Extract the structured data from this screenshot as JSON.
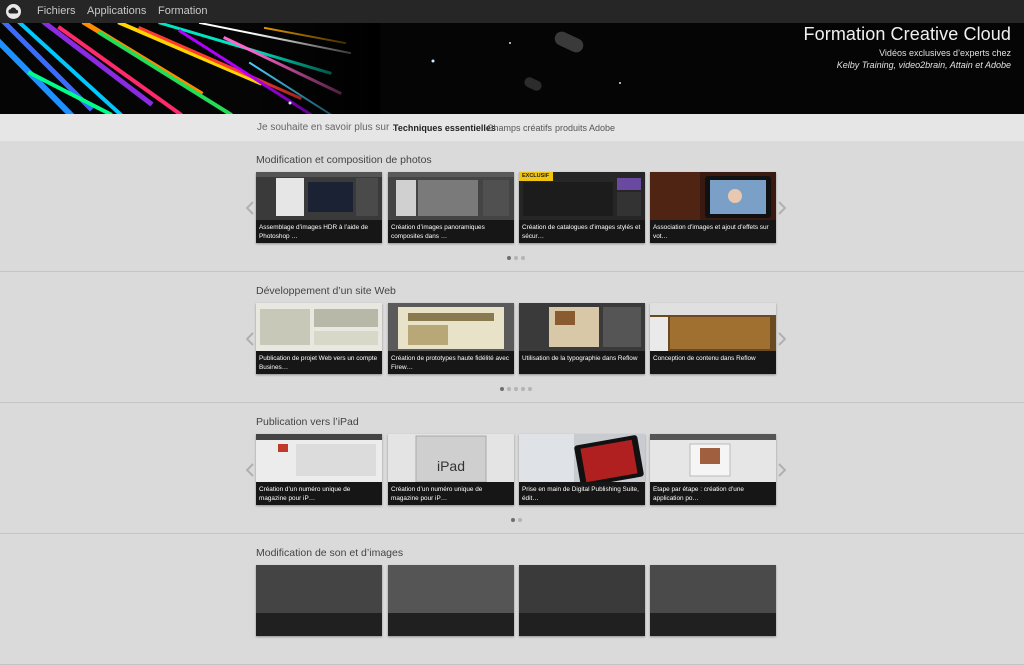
{
  "topbar": {
    "nav": [
      "Fichiers",
      "Applications",
      "Formation"
    ]
  },
  "banner": {
    "title": "Formation Creative Cloud",
    "subtitle_line1": "Vidéos exclusives d’experts chez",
    "subtitle_line2": "Kelby Training, video2brain, Attain et Adobe"
  },
  "filter": {
    "label": "Je souhaite en savoir plus sur :",
    "options": [
      "Techniques essentielles",
      "Champs créatifs",
      "produits Adobe"
    ],
    "active_index": 0
  },
  "sections": [
    {
      "title": "Modification et composition de photos",
      "cards": [
        {
          "caption": "Assemblage d’images HDR à l’aide de Photoshop …",
          "badge": ""
        },
        {
          "caption": "Création d’images panoramiques composites dans …",
          "badge": ""
        },
        {
          "caption": "Création de catalogues d’images stylés et sécur…",
          "badge": "EXCLUSIF"
        },
        {
          "caption": "Association d’images et ajout d’effets sur vot…",
          "badge": ""
        }
      ],
      "pages": 3,
      "current_page": 0
    },
    {
      "title": "Développement d’un site Web",
      "cards": [
        {
          "caption": "Publication de projet Web vers un compte Busines…",
          "badge": ""
        },
        {
          "caption": "Création de prototypes haute fidélité avec Firew…",
          "badge": ""
        },
        {
          "caption": "Utilisation de la typographie dans Reflow",
          "badge": ""
        },
        {
          "caption": "Conception de contenu dans Reflow",
          "badge": ""
        }
      ],
      "pages": 5,
      "current_page": 0
    },
    {
      "title": "Publication vers l’iPad",
      "cards": [
        {
          "caption": "Création d’un numéro unique de magazine pour iP…",
          "badge": ""
        },
        {
          "caption": "Création d’un numéro unique de magazine pour iP…",
          "badge": "",
          "thumb_text": "iPad"
        },
        {
          "caption": "Prise en main de Digital Publishing Suite, édit…",
          "badge": ""
        },
        {
          "caption": "Etape par étape : création d’une application po…",
          "badge": ""
        }
      ],
      "pages": 2,
      "current_page": 0
    },
    {
      "title": "Modification de son et d’images",
      "cards": [],
      "pages": 0,
      "current_page": 0
    }
  ]
}
